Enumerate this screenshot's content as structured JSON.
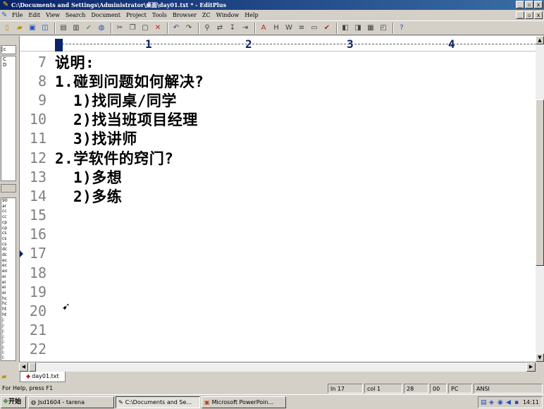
{
  "window": {
    "title": "C:\\Documents and Settings\\Administrator\\桌面\\day01.txt * - EditPlus",
    "buttons": [
      "_",
      "▫",
      "x"
    ]
  },
  "menu": [
    "File",
    "Edit",
    "View",
    "Search",
    "Document",
    "Project",
    "Tools",
    "Browser",
    "ZC",
    "Window",
    "Help"
  ],
  "toolbar": {
    "icons": [
      "new-file-icon",
      "open-file-icon",
      "save-icon",
      "save-all-icon",
      "print-preview-icon",
      "print-icon",
      "spell-check-icon",
      "browser-icon",
      "cut-icon",
      "copy-icon",
      "paste-icon",
      "delete-icon",
      "undo-icon",
      "redo-icon",
      "find-icon",
      "replace-icon",
      "goto-icon",
      "match-brace-icon",
      "font-icon",
      "hex-icon",
      "word-wrap-icon",
      "line-number-icon",
      "ruler-icon",
      "spell-icon",
      "window-icon",
      "cliptext-icon",
      "output-icon",
      "fullscreen-icon",
      "help-icon"
    ]
  },
  "left_panel": {
    "drive": "[c",
    "tree_items": [
      "C",
      "D"
    ],
    "files": [
      "90",
      "ar",
      "cc",
      "cc",
      "cp",
      "cp",
      "cs",
      "cs",
      "cs",
      "dc",
      "dc",
      "ec",
      "ec",
      "en",
      "ei",
      "ei",
      "ei",
      "ei",
      "hc",
      "hc",
      "ht",
      "ht",
      "j:",
      "j:",
      "j:",
      "j:",
      "j:",
      "j:",
      "l:",
      "l:"
    ],
    "filter": "A"
  },
  "ruler": {
    "numbers": [
      "1",
      "2",
      "3",
      "4"
    ]
  },
  "editor": {
    "lines": [
      {
        "num": "7",
        "text": "说明:",
        "indent": false
      },
      {
        "num": "8",
        "text": "1.碰到问题如何解决?",
        "indent": false
      },
      {
        "num": "9",
        "text": "1)找同桌/同学",
        "indent": true
      },
      {
        "num": "10",
        "text": "2)找当班项目经理",
        "indent": true
      },
      {
        "num": "11",
        "text": "3)找讲师",
        "indent": true
      },
      {
        "num": "12",
        "text": "2.学软件的窍门?",
        "indent": false
      },
      {
        "num": "13",
        "text": "1)多想",
        "indent": true
      },
      {
        "num": "14",
        "text": "2)多练",
        "indent": true
      },
      {
        "num": "15",
        "text": "",
        "indent": false
      },
      {
        "num": "16",
        "text": "",
        "indent": false
      },
      {
        "num": "17",
        "text": "",
        "indent": false
      },
      {
        "num": "18",
        "text": "",
        "indent": false
      },
      {
        "num": "19",
        "text": "",
        "indent": false
      },
      {
        "num": "20",
        "text": "",
        "indent": false
      },
      {
        "num": "21",
        "text": "",
        "indent": false
      },
      {
        "num": "22",
        "text": "",
        "indent": false
      }
    ],
    "current_line": "17"
  },
  "doc_tab": {
    "label": "day01.txt"
  },
  "status": {
    "help": "For Help, press F1",
    "ln": "ln 17",
    "col": "col 1",
    "total": "28",
    "mode": "00",
    "type": "PC",
    "encoding": "ANSI"
  },
  "taskbar": {
    "start": "开始",
    "tasks": [
      {
        "label": "Jsd1604 - tarena",
        "active": false
      },
      {
        "label": "C:\\Documents and Se...",
        "active": true
      },
      {
        "label": "Microsoft PowerPoin...",
        "active": false
      }
    ],
    "clock": "14:11"
  }
}
